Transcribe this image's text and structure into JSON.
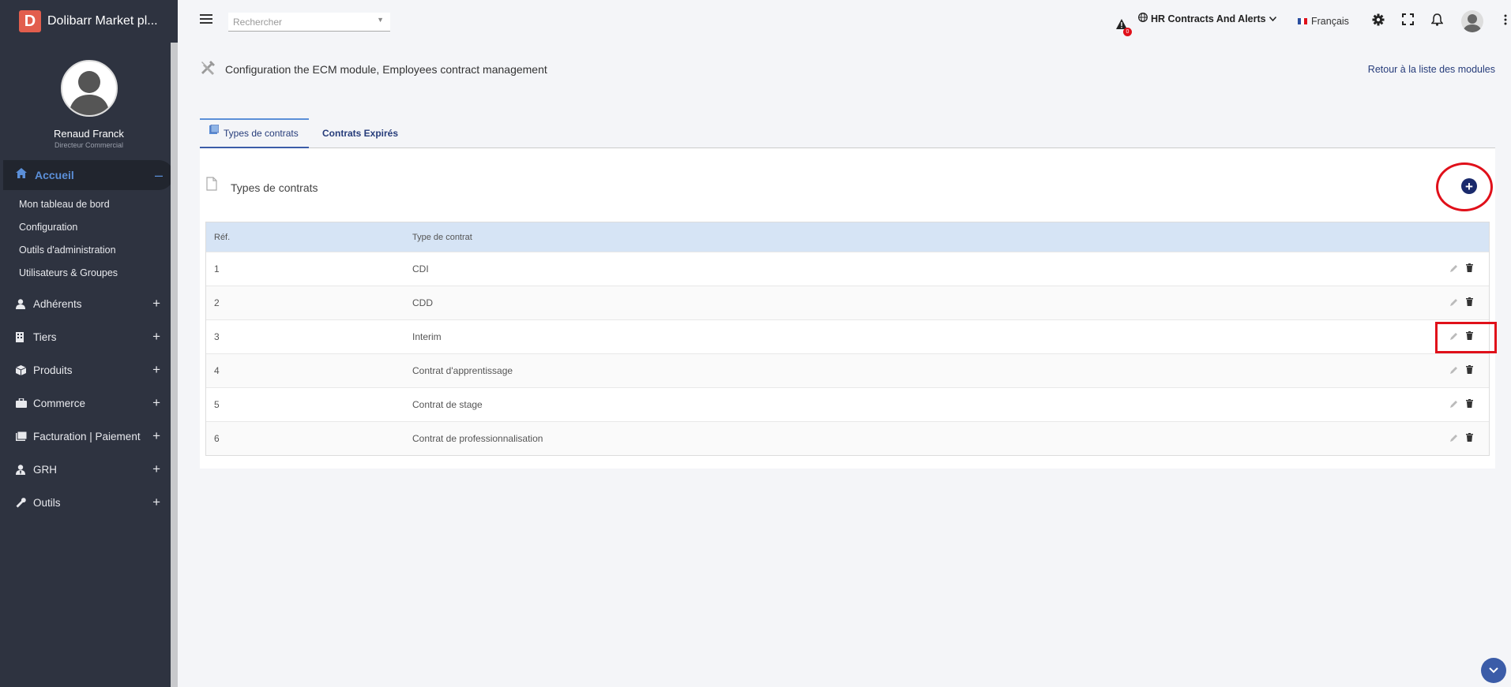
{
  "app": {
    "logo_letter": "D",
    "name": "Dolibarr Market pl..."
  },
  "profile": {
    "name": "Renaud Franck",
    "role": "Directeur Commercial"
  },
  "menu": {
    "home": {
      "label": "Accueil",
      "icon": "home-icon",
      "expand": "–"
    },
    "sub_items": [
      {
        "label": "Mon tableau de bord"
      },
      {
        "label": "Configuration"
      },
      {
        "label": "Outils d'administration"
      },
      {
        "label": "Utilisateurs & Groupes"
      }
    ],
    "items": [
      {
        "label": "Adhérents",
        "icon": "user-icon",
        "expand": "+"
      },
      {
        "label": "Tiers",
        "icon": "building-icon",
        "expand": "+"
      },
      {
        "label": "Produits",
        "icon": "cube-icon",
        "expand": "+"
      },
      {
        "label": "Commerce",
        "icon": "briefcase-icon",
        "expand": "+"
      },
      {
        "label": "Facturation | Paiement",
        "icon": "bill-icon",
        "expand": "+"
      },
      {
        "label": "GRH",
        "icon": "user-tie-icon",
        "expand": "+"
      },
      {
        "label": "Outils",
        "icon": "wrench-icon",
        "expand": "+"
      }
    ]
  },
  "topbar": {
    "search_placeholder": "Rechercher",
    "alert_count": "0",
    "module_selector": "HR Contracts And Alerts",
    "language": "Français"
  },
  "page": {
    "title": "Configuration the ECM module, Employees contract management",
    "back_link": "Retour à la liste des modules",
    "tabs": [
      {
        "label": "Types de contrats",
        "active": true
      },
      {
        "label": "Contrats Expirés",
        "active": false
      }
    ],
    "card_title": "Types de contrats"
  },
  "table": {
    "headers": [
      "Réf.",
      "Type de contrat"
    ],
    "rows": [
      {
        "ref": "1",
        "type": "CDI"
      },
      {
        "ref": "2",
        "type": "CDD"
      },
      {
        "ref": "3",
        "type": "Interim"
      },
      {
        "ref": "4",
        "type": "Contrat d'apprentissage"
      },
      {
        "ref": "5",
        "type": "Contrat de stage"
      },
      {
        "ref": "6",
        "type": "Contrat de professionnalisation"
      }
    ]
  },
  "colors": {
    "sidebar": "#2e3340",
    "accent": "#5b8fd8",
    "link": "#263c7a",
    "highlight": "#e0101a",
    "table_header": "#d6e4f5"
  }
}
